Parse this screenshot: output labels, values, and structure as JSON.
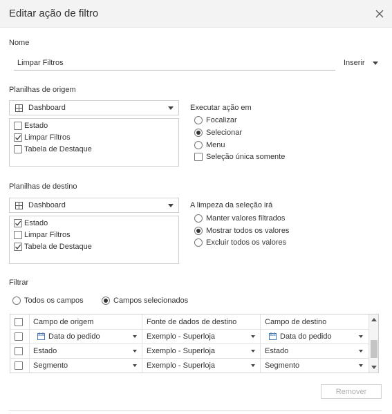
{
  "dialog": {
    "title": "Editar ação de filtro"
  },
  "name": {
    "label": "Nome",
    "value": "Limpar Filtros",
    "insert_label": "Inserir"
  },
  "source": {
    "label": "Planilhas de origem",
    "dropdown": "Dashboard",
    "sheets": [
      {
        "label": "Estado",
        "checked": false
      },
      {
        "label": "Limpar Filtros",
        "checked": true
      },
      {
        "label": "Tabela de Destaque",
        "checked": false
      }
    ]
  },
  "run_action": {
    "label": "Executar ação em",
    "options": [
      "Focalizar",
      "Selecionar",
      "Menu"
    ],
    "selected": "Selecionar",
    "single_select_label": "Seleção única somente",
    "single_select_checked": false
  },
  "target": {
    "label": "Planilhas de destino",
    "dropdown": "Dashboard",
    "sheets": [
      {
        "label": "Estado",
        "checked": true
      },
      {
        "label": "Limpar Filtros",
        "checked": false
      },
      {
        "label": "Tabela de Destaque",
        "checked": true
      }
    ]
  },
  "clearing": {
    "label": "A limpeza da seleção irá",
    "options": [
      "Manter valores filtrados",
      "Mostrar todos os valores",
      "Excluir todos os valores"
    ],
    "selected": "Mostrar todos os valores"
  },
  "filter": {
    "label": "Filtrar",
    "options": [
      "Todos os campos",
      "Campos selecionados"
    ],
    "selected": "Campos selecionados",
    "columns": [
      "Campo de origem",
      "Fonte de dados de destino",
      "Campo de destino"
    ],
    "rows": [
      {
        "source_field": "Data do pedido",
        "data_source": "Exemplo - Superloja",
        "target_field": "Data do pedido",
        "date_icon": true
      },
      {
        "source_field": "Estado",
        "data_source": "Exemplo - Superloja",
        "target_field": "Estado",
        "date_icon": false
      },
      {
        "source_field": "Segmento",
        "data_source": "Exemplo - Superloja",
        "target_field": "Segmento",
        "date_icon": false
      }
    ],
    "remove_label": "Remover"
  }
}
